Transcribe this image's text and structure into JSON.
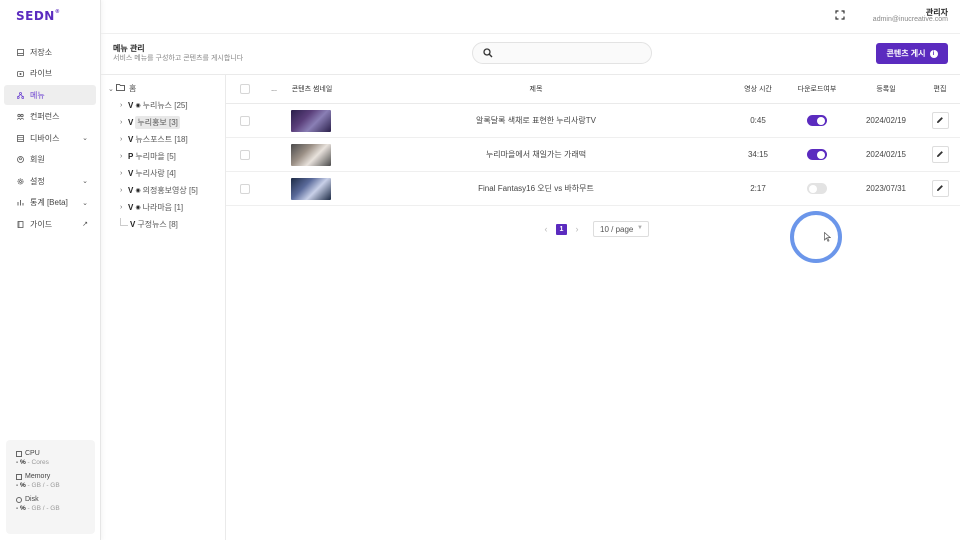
{
  "app": {
    "logo": "SEDN"
  },
  "header": {
    "user_name": "관리자",
    "user_email": "admin@inucreative.com"
  },
  "sidebar": {
    "items": [
      {
        "label": "저장소",
        "icon": "drive-icon",
        "active": false
      },
      {
        "label": "라이브",
        "icon": "live-icon",
        "active": false
      },
      {
        "label": "메뉴",
        "icon": "menu-tree-icon",
        "active": true
      },
      {
        "label": "컨퍼런스",
        "icon": "conference-icon",
        "active": false
      },
      {
        "label": "디바이스",
        "icon": "device-icon",
        "active": false,
        "chevron": true
      },
      {
        "label": "회원",
        "icon": "user-icon",
        "active": false
      },
      {
        "label": "설정",
        "icon": "gear-icon",
        "active": false,
        "chevron": true
      },
      {
        "label": "통계 [Beta]",
        "icon": "chart-icon",
        "active": false,
        "chevron": true
      },
      {
        "label": "가이드",
        "icon": "guide-icon",
        "active": false,
        "external": true
      }
    ],
    "system": {
      "cpu": {
        "label": "CPU",
        "value": "- %",
        "detail": " - Cores"
      },
      "memory": {
        "label": "Memory",
        "value": "- %",
        "detail": " - GB / - GB"
      },
      "disk": {
        "label": "Disk",
        "value": "- %",
        "detail": " - GB / - GB"
      }
    }
  },
  "page": {
    "title": "메뉴 관리",
    "description": "서비스 메뉴를 구성하고 콘텐츠를 게시합니다",
    "search_placeholder": "",
    "post_button": "콘텐츠 게시"
  },
  "tree": {
    "root": "홈",
    "children": [
      {
        "badge": "V",
        "eye": true,
        "label": "누리뉴스 [25]",
        "expandable": true,
        "selected": false
      },
      {
        "badge": "V",
        "eye": false,
        "label": "누리홍보 [3]",
        "expandable": true,
        "selected": true
      },
      {
        "badge": "V",
        "eye": false,
        "label": "뉴스포스트 [18]",
        "expandable": true,
        "selected": false
      },
      {
        "badge": "P",
        "eye": false,
        "label": "누리마을 [5]",
        "expandable": true,
        "selected": false
      },
      {
        "badge": "V",
        "eye": false,
        "label": "누리사랑 [4]",
        "expandable": true,
        "selected": false
      },
      {
        "badge": "V",
        "eye": true,
        "label": "의정홍보영상 [5]",
        "expandable": true,
        "selected": false
      },
      {
        "badge": "V",
        "eye": true,
        "label": "나라마음 [1]",
        "expandable": true,
        "selected": false
      },
      {
        "badge": "V",
        "eye": false,
        "label": "구정뉴스 [8]",
        "expandable": false,
        "selected": false
      }
    ]
  },
  "table": {
    "headers": {
      "more": "...",
      "thumbnail": "콘텐츠 썸네일",
      "title": "제목",
      "duration": "영상 시간",
      "download": "다운로드여부",
      "date": "등록일",
      "edit": "편집"
    },
    "rows": [
      {
        "title": "알록달록 색채로 표현한 누리사랑TV",
        "duration": "0:45",
        "download": true,
        "date": "2024/02/19",
        "thumb_colors": [
          "#2a1f4a",
          "#8a7fb5",
          "#5a3e7a"
        ]
      },
      {
        "title": "누리마을에서 채일가는 가래떡",
        "duration": "34:15",
        "download": true,
        "date": "2024/02/15",
        "thumb_colors": [
          "#4a4a4a",
          "#e8e2dc",
          "#9a8f85"
        ]
      },
      {
        "title": "Final Fantasy16 오딘 vs 바하무트",
        "duration": "2:17",
        "download": false,
        "date": "2023/07/31",
        "thumb_colors": [
          "#1c2a44",
          "#c8d0e8",
          "#5a6a9a"
        ]
      }
    ]
  },
  "pagination": {
    "current": "1",
    "page_size": "10 / page"
  },
  "colors": {
    "accent": "#5b2bbf",
    "cursor_ring": "#6b96ea"
  }
}
